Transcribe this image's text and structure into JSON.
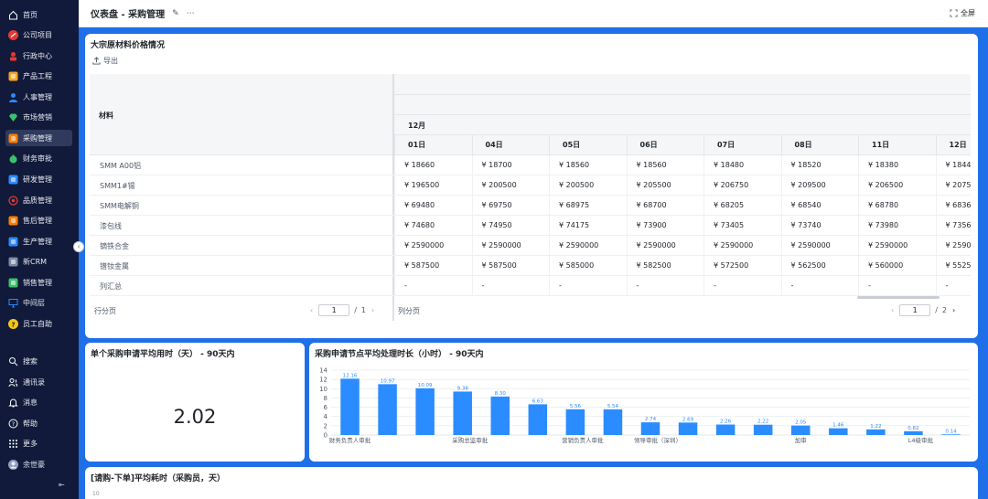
{
  "header": {
    "title": "仪表盘 - 采购管理",
    "fullscreen_label": "全屏"
  },
  "sidebar": {
    "items": [
      {
        "label": "首页",
        "icon": "home-icon",
        "color": "#ffffff"
      },
      {
        "label": "公司项目",
        "icon": "project-icon",
        "color": "#e53935"
      },
      {
        "label": "行政中心",
        "icon": "admin-icon",
        "color": "#e53935"
      },
      {
        "label": "产品工程",
        "icon": "product-icon",
        "color": "#f5a623"
      },
      {
        "label": "人事管理",
        "icon": "people-icon",
        "color": "#2f88ff"
      },
      {
        "label": "市场营销",
        "icon": "diamond-icon",
        "color": "#3cc06b"
      },
      {
        "label": "采购管理",
        "icon": "cart-icon",
        "color": "#ff7d00",
        "active": true
      },
      {
        "label": "财务审批",
        "icon": "money-bag-icon",
        "color": "#3cc06b"
      },
      {
        "label": "研发管理",
        "icon": "code-icon",
        "color": "#2f88ff"
      },
      {
        "label": "品质管理",
        "icon": "target-icon",
        "color": "#e53935"
      },
      {
        "label": "售后管理",
        "icon": "service-icon",
        "color": "#ff7d00"
      },
      {
        "label": "生产管理",
        "icon": "production-icon",
        "color": "#2f88ff"
      },
      {
        "label": "新CRM",
        "icon": "crm-icon",
        "color": "#7d8aa5"
      },
      {
        "label": "销售管理",
        "icon": "sales-icon",
        "color": "#3cc06b"
      },
      {
        "label": "中间层",
        "icon": "monitor-icon",
        "color": "#2f88ff"
      },
      {
        "label": "员工自助",
        "icon": "help-circle-icon",
        "color": "#f5c518"
      }
    ],
    "bottom_items": [
      {
        "label": "搜索",
        "icon": "search-icon"
      },
      {
        "label": "通讯录",
        "icon": "contacts-icon"
      },
      {
        "label": "消息",
        "icon": "bell-icon"
      },
      {
        "label": "帮助",
        "icon": "help-icon"
      },
      {
        "label": "更多",
        "icon": "grid-icon"
      },
      {
        "label": "余世豪",
        "icon": "avatar"
      }
    ]
  },
  "table_card": {
    "title": "大宗原材料价格情况",
    "export_label": "导出",
    "material_header": "材料",
    "month": "12月",
    "dates": [
      "01日",
      "04日",
      "05日",
      "06日",
      "07日",
      "08日",
      "11日",
      "12日"
    ],
    "rows": [
      {
        "name": "SMM A00铝",
        "values": [
          "¥ 18660",
          "¥ 18700",
          "¥ 18560",
          "¥ 18560",
          "¥ 18480",
          "¥ 18520",
          "¥ 18380",
          "¥ 1844"
        ]
      },
      {
        "name": "SMM1#锡",
        "values": [
          "¥ 196500",
          "¥ 200500",
          "¥ 200500",
          "¥ 205500",
          "¥ 206750",
          "¥ 209500",
          "¥ 206500",
          "¥ 2075"
        ]
      },
      {
        "name": "SMM电解铜",
        "values": [
          "¥ 69480",
          "¥ 69750",
          "¥ 68975",
          "¥ 68700",
          "¥ 68205",
          "¥ 68540",
          "¥ 68780",
          "¥ 6836"
        ]
      },
      {
        "name": "漆包线",
        "values": [
          "¥ 74680",
          "¥ 74950",
          "¥ 74175",
          "¥ 73900",
          "¥ 73405",
          "¥ 73740",
          "¥ 73980",
          "¥ 7356"
        ]
      },
      {
        "name": "镝铁合金",
        "values": [
          "¥ 2590000",
          "¥ 2590000",
          "¥ 2590000",
          "¥ 2590000",
          "¥ 2590000",
          "¥ 2590000",
          "¥ 2590000",
          "¥ 2590"
        ]
      },
      {
        "name": "镨钕金属",
        "values": [
          "¥ 587500",
          "¥ 587500",
          "¥ 585000",
          "¥ 582500",
          "¥ 572500",
          "¥ 562500",
          "¥ 560000",
          "¥ 5525"
        ]
      },
      {
        "name": "列汇总",
        "values": [
          "-",
          "-",
          "-",
          "-",
          "-",
          "-",
          "-",
          "-"
        ]
      }
    ],
    "row_pager": {
      "label": "行分页",
      "page": "1",
      "total": "1"
    },
    "col_pager": {
      "label": "列分页",
      "page": "1",
      "total": "2"
    }
  },
  "kpi_card": {
    "title": "单个采购申请平均用时（天） - 90天内",
    "value": "2.02"
  },
  "chart_card": {
    "title": "采购申请节点平均处理时长（小时） - 90天内"
  },
  "bottom_card": {
    "title": "[请购-下单]平均耗时（采购员，天）",
    "axis_top": "10"
  },
  "chart_data": {
    "type": "bar",
    "title": "采购申请节点平均处理时长（小时） - 90天内",
    "xlabel": "",
    "ylabel": "",
    "ylim": [
      0,
      14
    ],
    "yticks": [
      0,
      2,
      4,
      6,
      8,
      10,
      12,
      14
    ],
    "grid": true,
    "color": "#2b8cff",
    "categories": [
      "财务负责人审批",
      "",
      "",
      "采购总监审批",
      "",
      "",
      "营销负责人审批",
      "",
      "领导审批（深圳）",
      "",
      "",
      "",
      "加审",
      "",
      "",
      "L4级审批",
      ""
    ],
    "values": [
      12.16,
      10.97,
      10.09,
      9.38,
      8.3,
      6.63,
      5.56,
      5.54,
      2.74,
      2.69,
      2.26,
      2.22,
      2.05,
      1.46,
      1.22,
      0.82,
      0.14
    ],
    "labels": [
      "12.16",
      "10.97",
      "10.09",
      "9.38",
      "8.30",
      "6.63",
      "5.56",
      "5.54",
      "2.74",
      "2.69",
      "2.26",
      "2.22",
      "2.05",
      "1.46",
      "1.22",
      "0.82",
      "0.14"
    ]
  }
}
